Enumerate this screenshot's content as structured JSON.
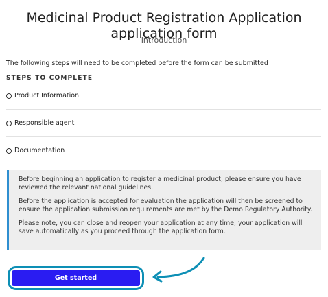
{
  "header": {
    "title": "Medicinal Product Registration Application application form",
    "subtitle": "Introduction"
  },
  "intro": {
    "text": "The following steps will need to be completed before the form can be submitted"
  },
  "steps": {
    "heading": "STEPS TO COMPLETE",
    "items": [
      {
        "label": "Product Information",
        "status": "incomplete"
      },
      {
        "label": "Responsible agent",
        "status": "incomplete"
      },
      {
        "label": "Documentation",
        "status": "incomplete"
      }
    ]
  },
  "info": {
    "paragraphs": [
      "Before beginning an application to register a medicinal product, please ensure you have reviewed the relevant national guidelines.",
      "Before the application is accepted for evaluation the application will then be screened to ensure the application submission requirements are met by the Demo Regulatory Authority.",
      "Please note, you can close and reopen your application at any time; your application will save automatically as you proceed through the application form."
    ],
    "accent_color": "#2f8fd0"
  },
  "actions": {
    "get_started_label": "Get started",
    "button_color": "#2a1cf2",
    "highlight_color": "#0d8fb5"
  }
}
